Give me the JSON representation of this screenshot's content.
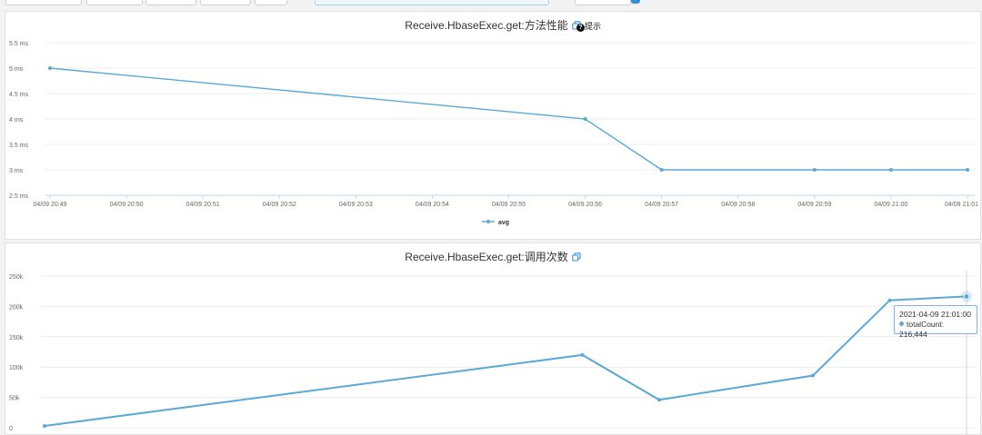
{
  "colors": {
    "series": "#5aa9d6",
    "accent": "#3a8fd4"
  },
  "icons": {
    "copy": "copy-icon",
    "hint": "question-circle-icon"
  },
  "hint_label": "提示",
  "tooltip": {
    "date": "2021-04-09 21:01:00",
    "label": "totalCount:",
    "value": "216,444"
  },
  "chart_data": [
    {
      "type": "line",
      "title": "Receive.HbaseExec.get:方法性能",
      "xlabel": "",
      "ylabel": "",
      "x_ticks": [
        "04/09 20:49",
        "04/09 20:50",
        "04/09 20:51",
        "04/09 20:52",
        "04/09 20:53",
        "04/09 20:54",
        "04/09 20:55",
        "04/09 20:56",
        "04/09 20:57",
        "04/09 20:58",
        "04/09 20:59",
        "04/09 21:00",
        "04/09 21:01"
      ],
      "y_ticks": [
        "2.5 ms",
        "3 ms",
        "3.5 ms",
        "4 ms",
        "4.5 ms",
        "5 ms",
        "5.5 ms"
      ],
      "ylim": [
        2.5,
        5.5
      ],
      "grid": true,
      "legend": "bottom-center",
      "series": [
        {
          "name": "avg",
          "points": [
            {
              "x": "04/09 20:49",
              "y": 5
            },
            {
              "x": "04/09 20:56",
              "y": 4
            },
            {
              "x": "04/09 20:57",
              "y": 3
            },
            {
              "x": "04/09 20:59",
              "y": 3
            },
            {
              "x": "04/09 21:00",
              "y": 3
            },
            {
              "x": "04/09 21:01",
              "y": 3
            }
          ]
        }
      ]
    },
    {
      "type": "line",
      "title": "Receive.HbaseExec.get:调用次数",
      "xlabel": "",
      "ylabel": "",
      "x_range": [
        "04/09 20:49",
        "04/09 21:01"
      ],
      "y_ticks": [
        "0",
        "50k",
        "100k",
        "150k",
        "200k",
        "250k"
      ],
      "ylim": [
        0,
        250000
      ],
      "grid": true,
      "series": [
        {
          "name": "totalCount",
          "points": [
            {
              "x": "04/09 20:49",
              "y": 3000
            },
            {
              "x": "04/09 20:56",
              "y": 120000
            },
            {
              "x": "04/09 20:57",
              "y": 46000
            },
            {
              "x": "04/09 20:59",
              "y": 86000
            },
            {
              "x": "04/09 21:00",
              "y": 210000
            },
            {
              "x": "04/09 21:01",
              "y": 216444
            }
          ]
        }
      ]
    }
  ]
}
